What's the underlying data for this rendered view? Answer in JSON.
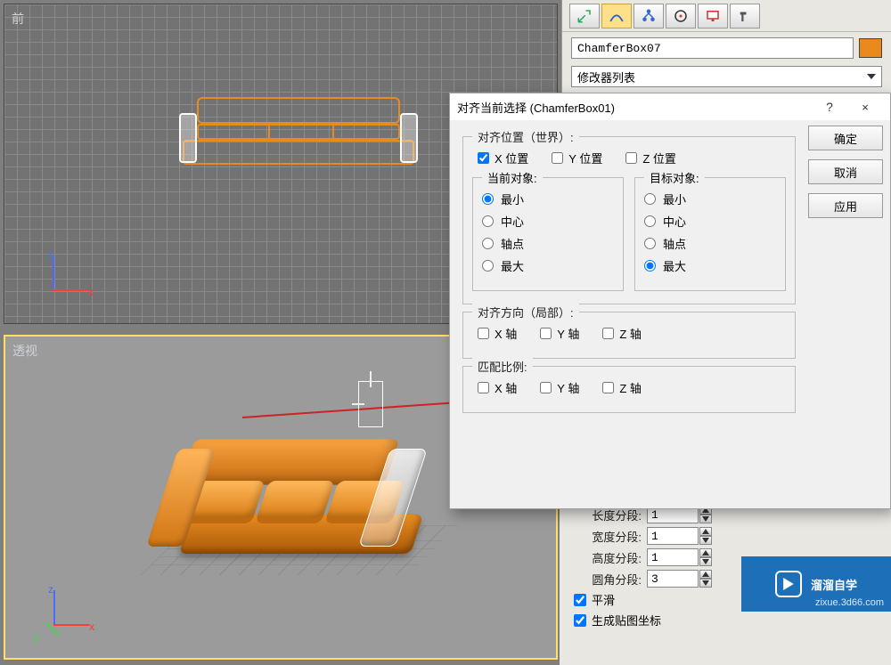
{
  "viewport": {
    "front_label": "前",
    "persp_label": "透视"
  },
  "panel": {
    "object_name": "ChamferBox07",
    "modifier_list": "修改器列表",
    "swatch_color": "#ea8a1c",
    "params": {
      "length_seg": {
        "label": "长度分段:",
        "value": "1"
      },
      "width_seg": {
        "label": "宽度分段:",
        "value": "1"
      },
      "height_seg": {
        "label": "高度分段:",
        "value": "1"
      },
      "fillet_seg": {
        "label": "圆角分段:",
        "value": "3"
      },
      "smooth": {
        "label": "平滑",
        "checked": true
      },
      "gen_uv": {
        "label": "生成贴图坐标",
        "checked": true
      }
    },
    "tabs": [
      "arrow-icon",
      "arc-icon",
      "hierarchy-icon",
      "motion-icon",
      "display-icon",
      "hammer-icon"
    ]
  },
  "dialog": {
    "title": "对齐当前选择 (ChamferBox01)",
    "group_pos": "对齐位置（世界）:",
    "x_pos": "X 位置",
    "y_pos": "Y 位置",
    "z_pos": "Z 位置",
    "current": "当前对象:",
    "target": "目标对象:",
    "opt_min": "最小",
    "opt_center": "中心",
    "opt_pivot": "轴点",
    "opt_max": "最大",
    "group_orient": "对齐方向（局部）:",
    "group_scale": "匹配比例:",
    "x_axis": "X 轴",
    "y_axis": "Y 轴",
    "z_axis": "Z 轴",
    "ok": "确定",
    "cancel": "取消",
    "apply": "应用",
    "help": "?",
    "close": "×",
    "checks": {
      "xpos": true,
      "ypos": false,
      "zpos": false,
      "ox": false,
      "oy": false,
      "oz": false,
      "sx": false,
      "sy": false,
      "sz": false
    },
    "radios": {
      "current": "最小",
      "target": "最大"
    }
  },
  "watermark": {
    "text": "溜溜自学",
    "sub": "zixue.3d66.com"
  }
}
